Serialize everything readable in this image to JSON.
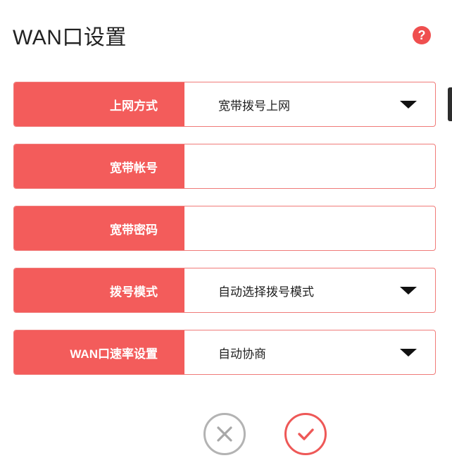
{
  "dialog": {
    "title": "WAN口设置",
    "help_symbol": "?"
  },
  "fields": {
    "connection_type": {
      "label": "上网方式",
      "value": "宽带拨号上网"
    },
    "account": {
      "label": "宽带帐号",
      "value": ""
    },
    "password": {
      "label": "宽带密码",
      "value": ""
    },
    "dial_mode": {
      "label": "拨号模式",
      "value": "自动选择拨号模式"
    },
    "wan_speed": {
      "label": "WAN口速率设置",
      "value": "自动协商"
    }
  },
  "colors": {
    "accent": "#f35c5b",
    "border": "#f07b79",
    "cancel_gray": "#b3b3b3",
    "confirm_red": "#ee5857"
  },
  "icons": {
    "help": "question-circle-icon",
    "cancel": "x-circle-icon",
    "confirm": "check-circle-icon",
    "dropdown": "caret-down-icon"
  }
}
